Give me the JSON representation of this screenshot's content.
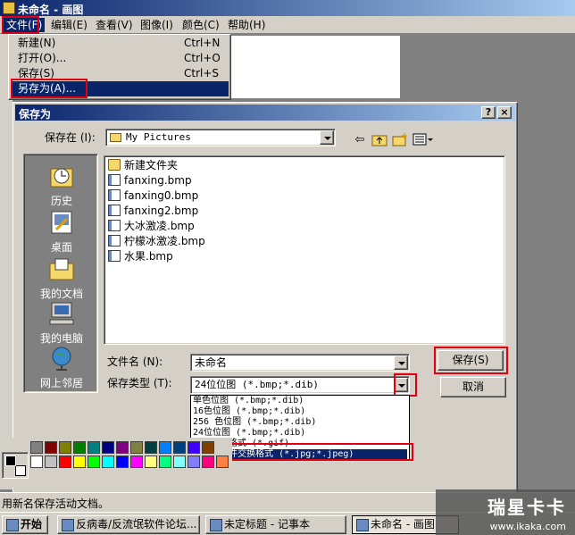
{
  "window": {
    "title": "未命名 - 画图"
  },
  "menubar": [
    "文件(F)",
    "编辑(E)",
    "查看(V)",
    "图像(I)",
    "颜色(C)",
    "帮助(H)"
  ],
  "file_menu": {
    "items": [
      {
        "label": "新建(N)",
        "shortcut": "Ctrl+N"
      },
      {
        "label": "打开(O)...",
        "shortcut": "Ctrl+O"
      },
      {
        "label": "保存(S)",
        "shortcut": "Ctrl+S"
      },
      {
        "label": "另存为(A)...",
        "shortcut": ""
      }
    ],
    "highlighted_index": 3
  },
  "dialog": {
    "title": "保存为",
    "help_button": "?",
    "close_button": "×",
    "save_in_label": "保存在 (I):",
    "save_in_value": "My Pictures",
    "places": [
      "历史",
      "桌面",
      "我的文档",
      "我的电脑",
      "网上邻居"
    ],
    "files": [
      {
        "name": "新建文件夹",
        "kind": "folder"
      },
      {
        "name": "fanxing.bmp",
        "kind": "bmp"
      },
      {
        "name": "fanxing0.bmp",
        "kind": "bmp"
      },
      {
        "name": "fanxing2.bmp",
        "kind": "bmp"
      },
      {
        "name": "大冰激凌.bmp",
        "kind": "bmp"
      },
      {
        "name": "柠檬冰激凌.bmp",
        "kind": "bmp"
      },
      {
        "name": "水果.bmp",
        "kind": "bmp"
      }
    ],
    "filename_label": "文件名 (N):",
    "filename_value": "未命名",
    "filetype_label": "保存类型 (T):",
    "filetype_value": "24位位图 (*.bmp;*.dib)",
    "save_button": "保存(S)",
    "cancel_button": "取消",
    "type_options": [
      "单色位图 (*.bmp;*.dib)",
      "16色位图 (*.bmp;*.dib)",
      "256 色位图 (*.bmp;*.dib)",
      "24位位图 (*.bmp;*.dib)",
      "图形交换格式 (*.gif)",
      "JPEG 文件交换格式 (*.jpg;*.jpeg)"
    ],
    "selected_type_index": 5
  },
  "palette": {
    "foreground": "#000000",
    "background": "#ffffff",
    "row1": [
      "#808080",
      "#800000",
      "#808000",
      "#008000",
      "#008080",
      "#000080",
      "#800080",
      "#808040",
      "#004040",
      "#0080ff",
      "#004080",
      "#4000ff",
      "#804000"
    ],
    "row2": [
      "#ffffff",
      "#c0c0c0",
      "#ff0000",
      "#ffff00",
      "#00ff00",
      "#00ffff",
      "#0000ff",
      "#ff00ff",
      "#ffff80",
      "#00ff80",
      "#80ffff",
      "#8080ff",
      "#ff0080",
      "#ff8040"
    ]
  },
  "status_text": "用新名保存活动文档。",
  "taskbar": {
    "start": "开始",
    "tasks": [
      "反病毒/反流氓软件论坛...",
      "未定标题 - 记事本",
      "未命名 - 画图"
    ],
    "active_index": 2
  },
  "watermark": {
    "brand": "瑞星卡卡",
    "url": "www.ikaka.com"
  },
  "accent": {
    "selection": "#0a246a",
    "annotation": "#e00010",
    "face": "#d4d0c8"
  }
}
